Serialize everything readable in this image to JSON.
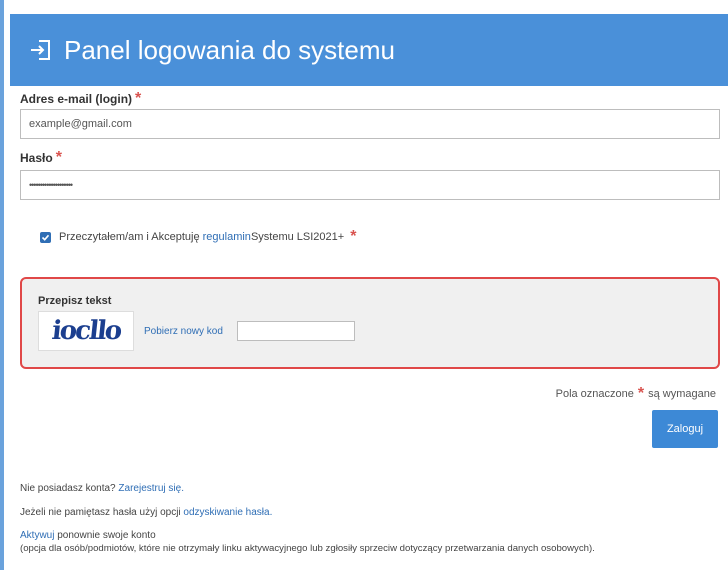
{
  "header": {
    "title": "Panel logowania do systemu",
    "icon": "login-icon"
  },
  "email": {
    "label": "Adres e-mail (login)",
    "required_mark": "*",
    "value": "example@gmail.com"
  },
  "password": {
    "label": "Hasło",
    "required_mark": "*",
    "value": "••••••••••••••••••••"
  },
  "terms": {
    "checked": true,
    "prefix": "Przeczytałem/am i Akceptuję ",
    "link": "regulamin",
    "suffix": " Systemu LSI2021+",
    "required_mark": "*"
  },
  "captcha": {
    "title": "Przepisz tekst",
    "image_text": "iocllo",
    "refresh_label": "Pobierz nowy kod",
    "input_value": ""
  },
  "required_note": {
    "prefix": "Pola oznaczone",
    "mark": "*",
    "suffix": "są wymagane"
  },
  "login_button": {
    "label": "Zaloguj"
  },
  "footer": {
    "register_prefix": "Nie posiadasz konta? ",
    "register_link": "Zarejestruj się.",
    "recover_prefix": "Jeżeli nie pamiętasz hasła użyj opcji ",
    "recover_link": "odzyskiwanie hasła.",
    "activate_link": "Aktywuj",
    "activate_suffix": " ponownie swoje konto",
    "activate_note": "(opcja dla osób/podmiotów, które nie otrzymały linku aktywacyjnego lub zgłosiły sprzeciw dotyczący przetwarzania danych osobowych)."
  },
  "colors": {
    "header": "#4a90d9",
    "button": "#3d89d6",
    "required": "#d9534f",
    "captcha_border": "#e04848",
    "link": "#2f6eb5"
  }
}
